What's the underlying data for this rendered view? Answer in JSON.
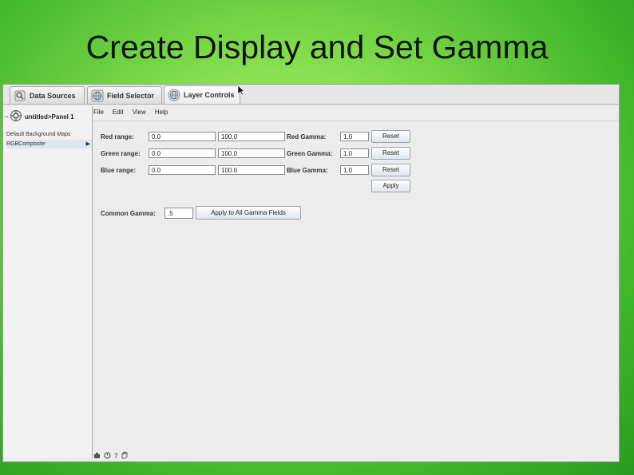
{
  "slide": {
    "title": "Create Display and Set Gamma"
  },
  "tabs": [
    {
      "label": "Data Sources",
      "icon": "magnifier-icon"
    },
    {
      "label": "Field Selector",
      "icon": "globe-icon"
    },
    {
      "label": "Layer Controls",
      "icon": "globe-icon",
      "active": true
    }
  ],
  "sidebar": {
    "root_label": "untitled>Panel 1",
    "items": [
      {
        "label": "Default Background Maps"
      },
      {
        "label": "RGBComposite",
        "selected": true
      }
    ]
  },
  "menu": [
    "File",
    "Edit",
    "View",
    "Help"
  ],
  "ranges": [
    {
      "label": "Red range:",
      "min": "0.0",
      "max": "100.0",
      "gamma_label": "Red Gamma:",
      "gamma": "1.0",
      "reset": "Reset"
    },
    {
      "label": "Green range:",
      "min": "0.0",
      "max": "100.0",
      "gamma_label": "Green Gamma:",
      "gamma": "1.0",
      "reset": "Reset"
    },
    {
      "label": "Blue range:",
      "min": "0.0",
      "max": "100.0",
      "gamma_label": "Blue Gamma:",
      "gamma": "1.0",
      "reset": "Reset"
    }
  ],
  "apply_label": "Apply",
  "common": {
    "label": "Common Gamma:",
    "value": ".5",
    "button": "Apply to All Gamma Fields"
  },
  "status": {
    "number": "7"
  },
  "colors": {
    "background": "#7fdc4a",
    "panel": "#ececec"
  }
}
